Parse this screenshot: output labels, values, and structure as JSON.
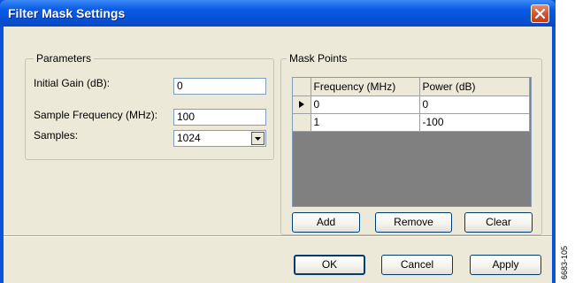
{
  "window": {
    "title": "Filter Mask Settings",
    "close_icon": "close-icon"
  },
  "parameters": {
    "legend": "Parameters",
    "initial_gain_label": "Initial Gain (dB):",
    "initial_gain_value": "0",
    "sample_frequency_label": "Sample Frequency (MHz):",
    "sample_frequency_value": "100",
    "samples_label": "Samples:",
    "samples_value": "1024"
  },
  "mask_points": {
    "legend": "Mask Points",
    "columns": [
      "Frequency (MHz)",
      "Power (dB)"
    ],
    "rows": [
      {
        "frequency": "0",
        "power": "0"
      },
      {
        "frequency": "1",
        "power": "-100"
      }
    ],
    "add_label": "Add",
    "remove_label": "Remove",
    "clear_label": "Clear"
  },
  "footer": {
    "ok_label": "OK",
    "cancel_label": "Cancel",
    "apply_label": "Apply"
  },
  "figure_id": "6683-105",
  "colors": {
    "titlebar": "#0a5be6",
    "client": "#ece9d8",
    "grid_background": "#808080"
  }
}
